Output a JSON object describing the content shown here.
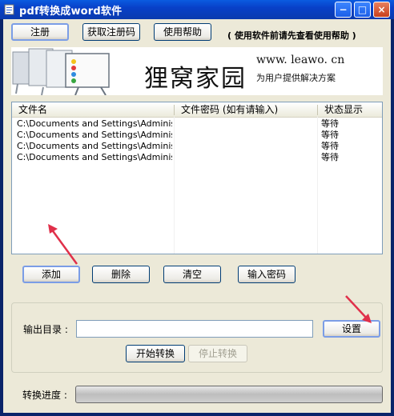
{
  "window": {
    "title": "pdf转换成word软件",
    "controls": {
      "minimize": "−",
      "maximize": "□",
      "close": "×"
    }
  },
  "toolbar": {
    "register_label": "注册",
    "get_code_label": "获取注册码",
    "help_label": "使用帮助",
    "hint": "( 使用软件前请先查看使用帮助 )"
  },
  "banner": {
    "brand": "狸窝家园",
    "url": "www. leawo. cn",
    "slogan": "为用户提供解决方案"
  },
  "file_list": {
    "columns": [
      "文件名",
      "文件密码 (如有请输入)",
      "状态显示"
    ],
    "rows": [
      {
        "name": "C:\\Documents and Settings\\Administr...",
        "password": "",
        "status": "等待"
      },
      {
        "name": "C:\\Documents and Settings\\Administr...",
        "password": "",
        "status": "等待"
      },
      {
        "name": "C:\\Documents and Settings\\Administr...",
        "password": "",
        "status": "等待"
      },
      {
        "name": "C:\\Documents and Settings\\Administr...",
        "password": "",
        "status": "等待"
      }
    ]
  },
  "list_actions": {
    "add_label": "添加",
    "delete_label": "删除",
    "clear_label": "清空",
    "password_label": "输入密码"
  },
  "output": {
    "dir_label": "输出目录 :",
    "dir_value": "",
    "set_label": "设置",
    "start_label": "开始转换",
    "stop_label": "停止转换"
  },
  "progress": {
    "label": "转换进度 :",
    "value": 0
  },
  "colors": {
    "titlebar": "#0a46d0",
    "window_bg": "#ece9d8",
    "annotation_arrow": "#e0304a"
  }
}
